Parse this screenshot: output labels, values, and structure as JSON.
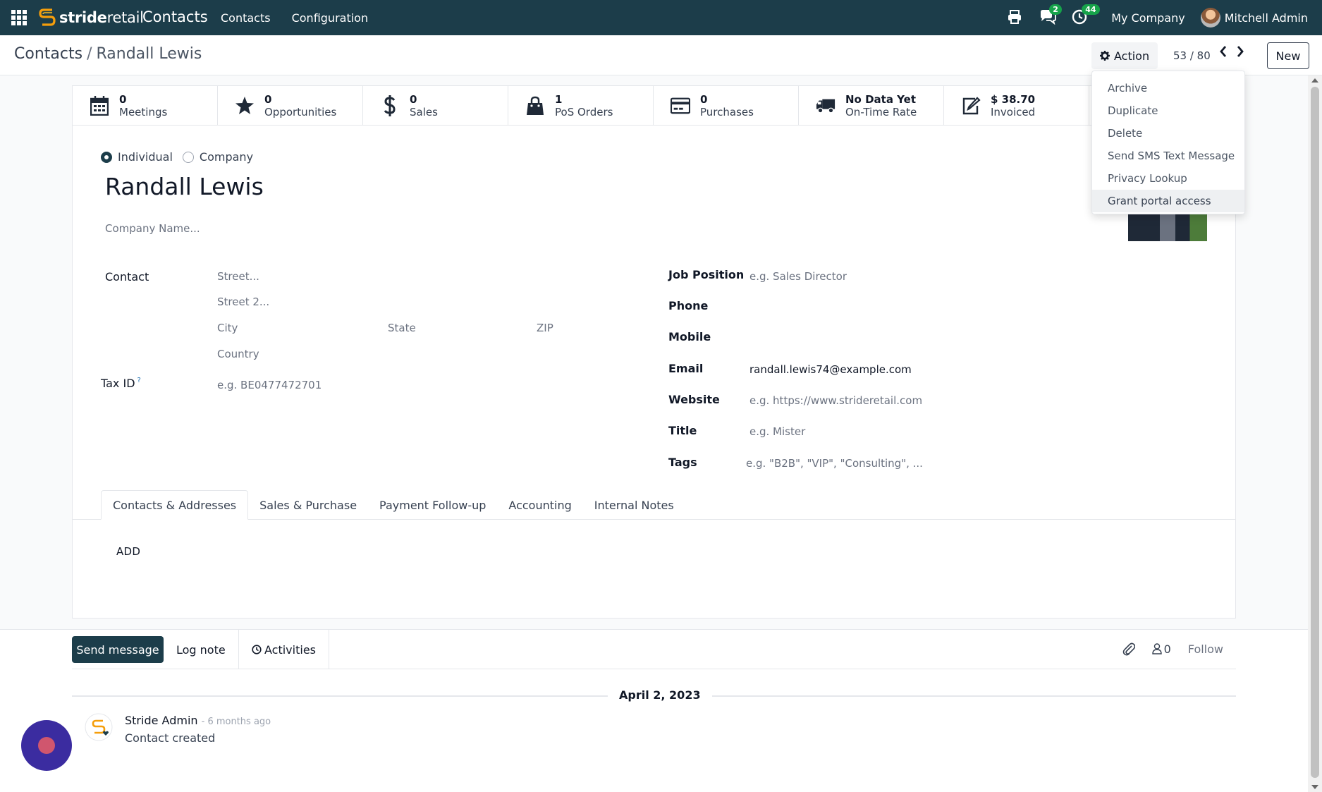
{
  "navbar": {
    "brand_prefix": "stride",
    "brand_suffix": "retail",
    "app_title": "Contacts",
    "menu": [
      "Contacts",
      "Configuration"
    ],
    "messages_count": "2",
    "activities_count": "44",
    "company": "My Company",
    "user": "Mitchell Admin",
    "badge_color": "#16a34a",
    "bar_color": "#1c3d4a"
  },
  "control": {
    "breadcrumb_root": "Contacts",
    "breadcrumb_separator": "/",
    "breadcrumb_current": "Randall Lewis",
    "action_label": "Action",
    "pager": "53 / 80",
    "new_label": "New"
  },
  "dropdown": {
    "items": [
      "Archive",
      "Duplicate",
      "Delete",
      "Send SMS Text Message",
      "Privacy Lookup",
      "Grant portal access"
    ],
    "highlighted": "Grant portal access"
  },
  "stats": [
    {
      "value": "0",
      "label": "Meetings",
      "icon": "calendar-icon"
    },
    {
      "value": "0",
      "label": "Opportunities",
      "icon": "star-icon"
    },
    {
      "value": "0",
      "label": "Sales",
      "icon": "dollar-icon"
    },
    {
      "value": "1",
      "label": "PoS Orders",
      "icon": "shopping-bag-icon"
    },
    {
      "value": "0",
      "label": "Purchases",
      "icon": "credit-card-icon"
    },
    {
      "value": "No Data Yet",
      "label": "On-Time Rate",
      "icon": "truck-icon"
    },
    {
      "value": "$ 38.70",
      "label": "Invoiced",
      "icon": "edit-icon"
    }
  ],
  "form": {
    "type_individual": "Individual",
    "type_company": "Company",
    "selected_type": "Individual",
    "name": "Randall Lewis",
    "company_placeholder": "Company Name...",
    "contact_label": "Contact",
    "street_placeholder": "Street...",
    "street2_placeholder": "Street 2...",
    "city_placeholder": "City",
    "state_placeholder": "State",
    "zip_placeholder": "ZIP",
    "country_placeholder": "Country",
    "taxid_label": "Tax ID",
    "taxid_help": "?",
    "taxid_placeholder": "e.g. BE0477472701",
    "job_label": "Job Position",
    "job_placeholder": "e.g. Sales Director",
    "phone_label": "Phone",
    "mobile_label": "Mobile",
    "email_label": "Email",
    "email_value": "randall.lewis74@example.com",
    "website_label": "Website",
    "website_placeholder": "e.g. https://www.strideretail.com",
    "title_label": "Title",
    "title_placeholder": "e.g. Mister",
    "tags_label": "Tags",
    "tags_placeholder": "e.g. \"B2B\", \"VIP\", \"Consulting\", ..."
  },
  "tabs": [
    "Contacts & Addresses",
    "Sales & Purchase",
    "Payment Follow-up",
    "Accounting",
    "Internal Notes"
  ],
  "active_tab": "Contacts & Addresses",
  "add_label": "ADD",
  "chatter": {
    "send_label": "Send message",
    "log_label": "Log note",
    "activities_label": "Activities",
    "followers_count": "0",
    "follow_label": "Follow",
    "date": "April 2, 2023",
    "author": "Stride Admin",
    "time": "- 6 months ago",
    "body": "Contact created"
  }
}
